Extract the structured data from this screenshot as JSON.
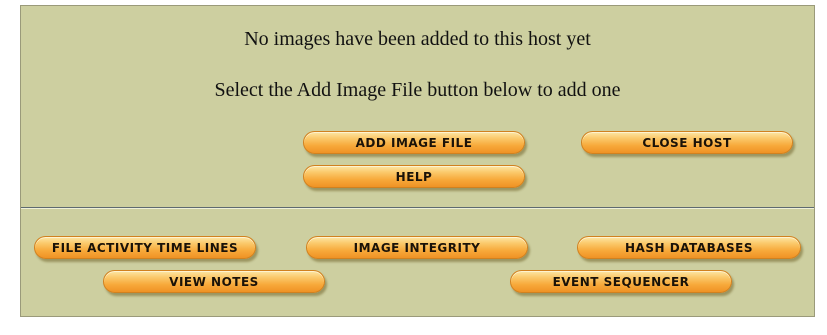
{
  "messages": {
    "no_images": "No images have been added to this host yet",
    "instruction": "Select the Add Image File button below to add one"
  },
  "host_buttons": {
    "add_image_file": "ADD IMAGE FILE",
    "close_host": "CLOSE HOST",
    "help": "HELP"
  },
  "nav_buttons": {
    "file_activity_time_lines": "FILE ACTIVITY TIME LINES",
    "image_integrity": "IMAGE INTEGRITY",
    "hash_databases": "HASH DATABASES",
    "view_notes": "VIEW NOTES",
    "event_sequencer": "EVENT SEQUENCER"
  }
}
